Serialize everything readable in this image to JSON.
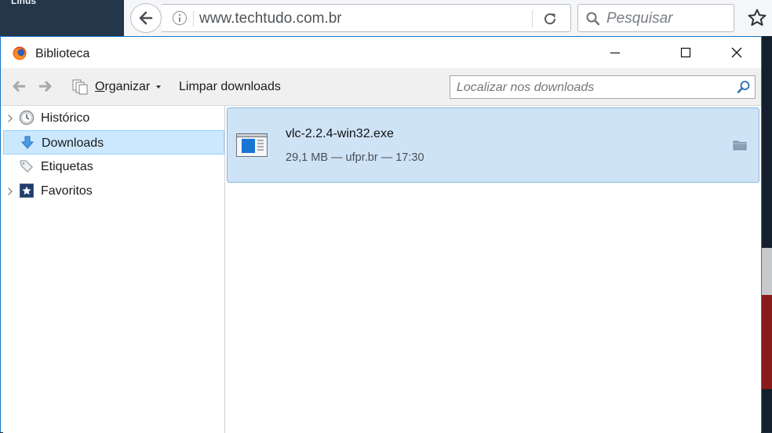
{
  "browser": {
    "url": "www.techtudo.com.br",
    "search_placeholder": "Pesquisar",
    "bg_left_text": "Linus"
  },
  "window": {
    "title": "Biblioteca"
  },
  "toolbar": {
    "organize_label_first": "O",
    "organize_label_rest": "rganizar",
    "clear_label": "Limpar downloads",
    "search_placeholder": "Localizar nos downloads"
  },
  "sidebar": {
    "items": [
      {
        "label": "Histórico",
        "icon": "clock-icon",
        "expandable": true
      },
      {
        "label": "Downloads",
        "icon": "download-arrow-icon",
        "selected": true
      },
      {
        "label": "Etiquetas",
        "icon": "tag-icon"
      },
      {
        "label": "Favoritos",
        "icon": "star-bookmark-icon",
        "expandable": true
      }
    ]
  },
  "downloads": [
    {
      "filename": "vlc-2.2.4-win32.exe",
      "status": "29,1 MB — ufpr.br — 17:30"
    }
  ],
  "colors": {
    "selected_row": "#cce8ff",
    "download_item_bg": "#cfe3f6",
    "window_border": "#1c78c8"
  }
}
